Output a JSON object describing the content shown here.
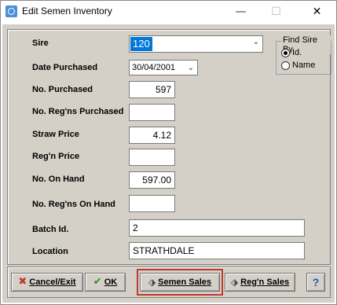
{
  "window": {
    "title": "Edit Semen Inventory",
    "controls": {
      "minimize": "—",
      "maximize": "☐",
      "close": "✕"
    }
  },
  "form": {
    "sire": {
      "label": "Sire",
      "value": "120"
    },
    "date_purchased": {
      "label": "Date Purchased",
      "value": "30/04/2001"
    },
    "no_purchased": {
      "label": "No. Purchased",
      "value": "597"
    },
    "no_regns_purchased": {
      "label": "No. Reg'ns Purchased",
      "value": ""
    },
    "straw_price": {
      "label": "Straw Price",
      "value": "4.12"
    },
    "regn_price": {
      "label": "Reg'n Price",
      "value": ""
    },
    "no_on_hand": {
      "label": "No. On Hand",
      "value": "597.00"
    },
    "no_regns_on_hand": {
      "label": "No. Reg'ns On Hand",
      "value": ""
    },
    "batch_id": {
      "label": "Batch Id.",
      "value": "2"
    },
    "location": {
      "label": "Location",
      "value": "STRATHDALE"
    }
  },
  "find_sire_by": {
    "title": "Find Sire By",
    "options": [
      {
        "label": "Id.",
        "selected": true
      },
      {
        "label": "Name",
        "selected": false
      }
    ]
  },
  "buttons": {
    "cancel_exit": {
      "label": "Cancel/Exit",
      "icon": "red-x-icon"
    },
    "ok": {
      "label": "OK",
      "icon": "green-check-icon"
    },
    "semen_sales": {
      "label": "Semen Sales",
      "icon": "eraser-icon"
    },
    "regn_sales": {
      "label": "Reg'n Sales",
      "icon": "eraser-icon"
    },
    "help": {
      "label": "?",
      "icon": "help-icon"
    }
  },
  "colors": {
    "highlight": "#c0392b",
    "selection": "#0078d7",
    "client_bg": "#d4d0c8"
  }
}
